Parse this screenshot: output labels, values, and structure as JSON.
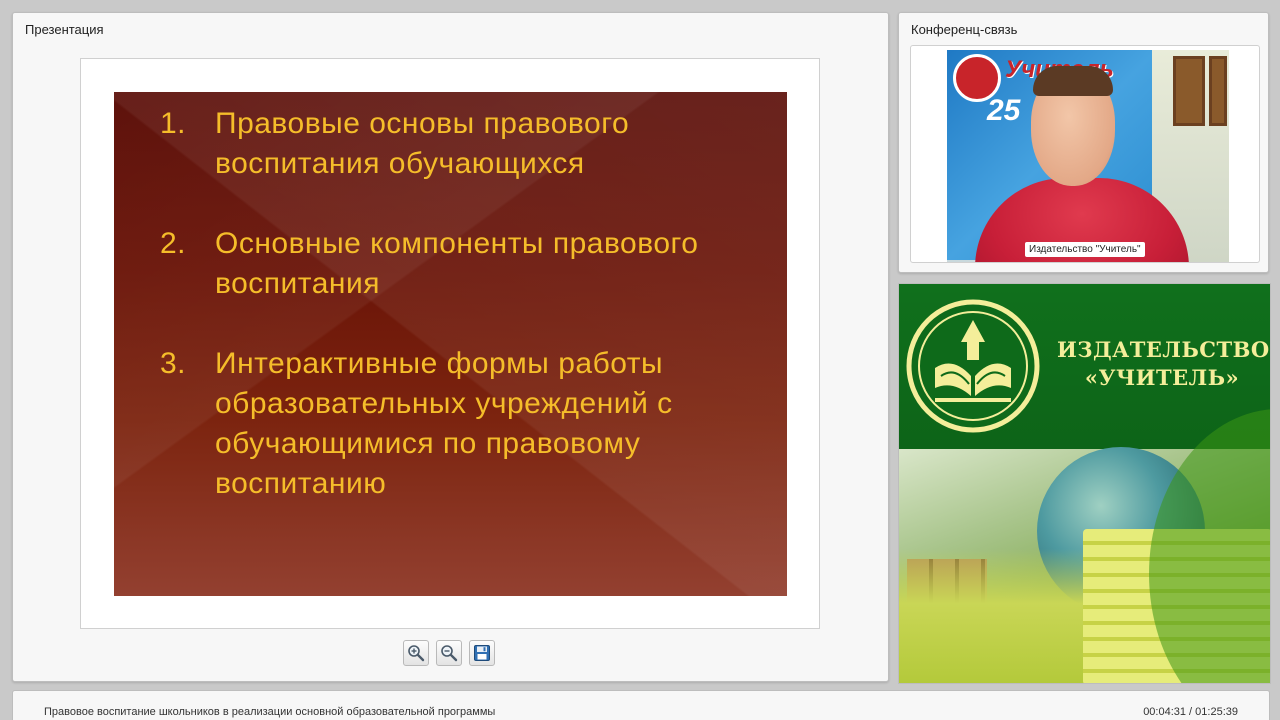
{
  "presentation": {
    "title": "Презентация",
    "slide": {
      "items": [
        {
          "num": "1.",
          "text": "Правовые основы правового воспитания обучающихся"
        },
        {
          "num": "2.",
          "text": " Основные компоненты правового воспитания"
        },
        {
          "num": "3.",
          "text": " Интерактивные формы работы образовательных учреждений с обучающимися по правовому воспитанию"
        }
      ],
      "text_color": "#f5bd2a",
      "background_color": "#6a1408"
    },
    "toolbar": {
      "zoom_in_icon": "zoom-in-icon",
      "zoom_out_icon": "zoom-out-icon",
      "save_icon": "floppy-disk-icon"
    }
  },
  "conference": {
    "title": "Конференц-связь",
    "video_caption": "Издательство \"Учитель\"",
    "backdrop_logo_text": "Учитель",
    "backdrop_number": "25"
  },
  "publisher": {
    "name_line1": "ИЗДАТЕЛЬСТВО",
    "name_line2": "«УЧИТЕЛЬ»",
    "brand_green": "#10701c",
    "brand_text_color": "#f4ee9a"
  },
  "footer": {
    "title": "Правовое воспитание школьников в реализации основной образовательной программы",
    "time": "00:04:31 / 01:25:39"
  }
}
